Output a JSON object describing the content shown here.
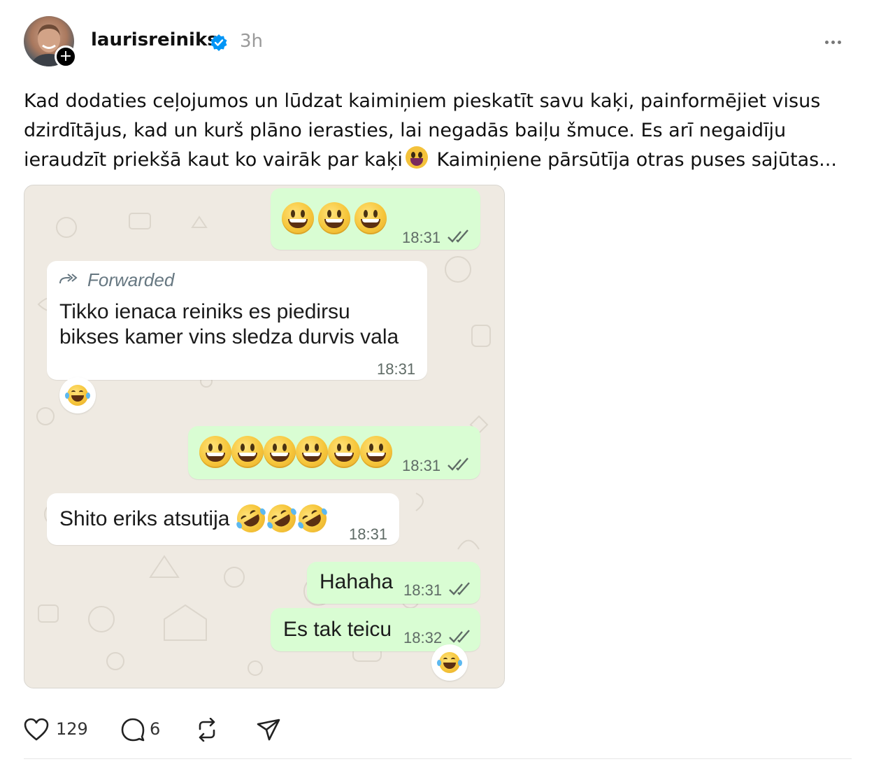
{
  "post": {
    "username": "laurisreiniks",
    "time": "3h",
    "caption_before_emoji": "Kad dodaties ceļojumos un lūdzat kaimiņiem pieskatīt savu kaķi, painformējiet visus dzirdītājus, kad un kurš plāno ierasties, lai negadās baiļu šmuce. Es arī negaidīju ieraudzīt priekšā kaut ko vairāk par kaķi",
    "caption_after_emoji": " Kaimiņiene pārsūtīja otras puses sajūtas...",
    "caption_emoji": "grinning-face-with-tongue-emoji",
    "accent_color": "#0095f6"
  },
  "chat": {
    "messages": [
      {
        "type": "outgoing",
        "content": "emoji",
        "emoji": "grinning-face-emoji",
        "emoji_count": 3,
        "time": "18:31",
        "status": "read"
      },
      {
        "type": "incoming",
        "forwarded_label": "Forwarded",
        "line1": "Tikko ienaca reiniks es piedirsu",
        "line2": "bikses kamer vins sledza durvis vala",
        "time": "18:31",
        "reaction": "tears-of-joy-emoji"
      },
      {
        "type": "outgoing",
        "content": "emoji",
        "emoji": "grinning-face-emoji",
        "emoji_count": 6,
        "time": "18:31",
        "status": "read"
      },
      {
        "type": "incoming",
        "text": "Shito eriks atsutija",
        "emoji": "rolling-on-floor-laughing-emoji",
        "emoji_count": 3,
        "time": "18:31"
      },
      {
        "type": "outgoing",
        "text": "Hahaha",
        "time": "18:31",
        "status": "read"
      },
      {
        "type": "outgoing",
        "text": "Es tak teicu",
        "time": "18:32",
        "status": "read",
        "reaction": "tears-of-joy-emoji"
      }
    ],
    "colors": {
      "background": "#efeae2",
      "outgoing": "#d9fdd3",
      "incoming": "#ffffff"
    }
  },
  "actions": {
    "likes": "129",
    "comments": "6",
    "icons": [
      "heart-icon",
      "comment-icon",
      "repost-icon",
      "share-icon"
    ]
  }
}
